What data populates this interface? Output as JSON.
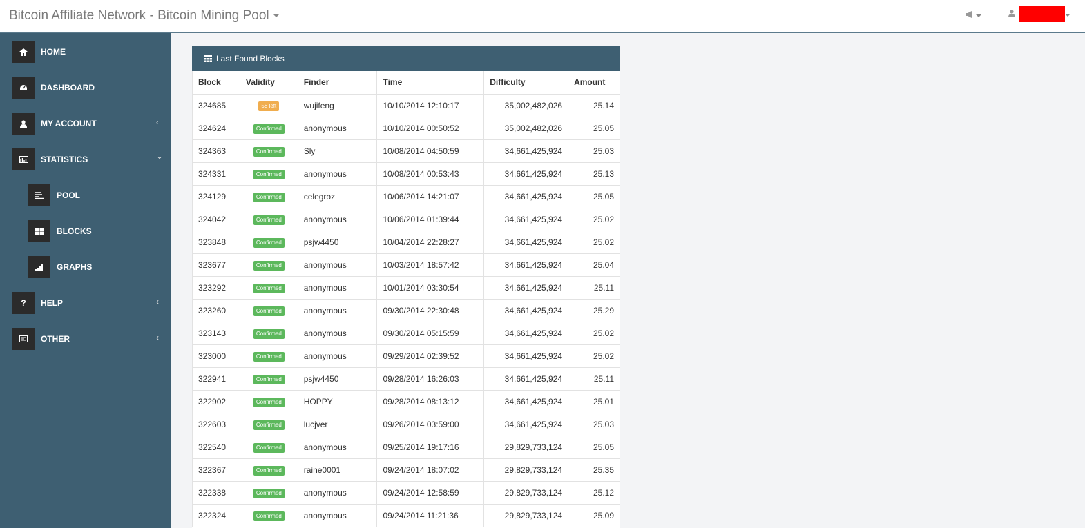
{
  "header": {
    "brand": "Bitcoin Affiliate Network - Bitcoin Mining Pool",
    "notify_icon": "bullhorn-icon",
    "user_icon": "user-icon"
  },
  "sidebar": {
    "items": [
      {
        "label": "HOME",
        "icon": "home-icon"
      },
      {
        "label": "DASHBOARD",
        "icon": "dashboard-icon"
      },
      {
        "label": "MY ACCOUNT",
        "icon": "user-icon",
        "chevron": "‹"
      },
      {
        "label": "STATISTICS",
        "icon": "chart-icon",
        "chevron": "⌄"
      },
      {
        "label": "POOL",
        "icon": "list-icon"
      },
      {
        "label": "BLOCKS",
        "icon": "table-icon"
      },
      {
        "label": "GRAPHS",
        "icon": "signal-icon"
      },
      {
        "label": "HELP",
        "icon": "question-icon",
        "chevron": "‹"
      },
      {
        "label": "OTHER",
        "icon": "other-icon",
        "chevron": "‹"
      }
    ]
  },
  "panel": {
    "title": "Last Found Blocks",
    "columns": [
      "Block",
      "Validity",
      "Finder",
      "Time",
      "Difficulty",
      "Amount"
    ],
    "rows": [
      {
        "block": "324685",
        "validity": "58 left",
        "status": "left",
        "finder": "wujifeng",
        "time": "10/10/2014 12:10:17",
        "difficulty": "35,002,482,026",
        "amount": "25.14"
      },
      {
        "block": "324624",
        "validity": "Confirmed",
        "status": "ok",
        "finder": "anonymous",
        "time": "10/10/2014 00:50:52",
        "difficulty": "35,002,482,026",
        "amount": "25.05"
      },
      {
        "block": "324363",
        "validity": "Confirmed",
        "status": "ok",
        "finder": "Sly",
        "time": "10/08/2014 04:50:59",
        "difficulty": "34,661,425,924",
        "amount": "25.03"
      },
      {
        "block": "324331",
        "validity": "Confirmed",
        "status": "ok",
        "finder": "anonymous",
        "time": "10/08/2014 00:53:43",
        "difficulty": "34,661,425,924",
        "amount": "25.13"
      },
      {
        "block": "324129",
        "validity": "Confirmed",
        "status": "ok",
        "finder": "celegroz",
        "time": "10/06/2014 14:21:07",
        "difficulty": "34,661,425,924",
        "amount": "25.05"
      },
      {
        "block": "324042",
        "validity": "Confirmed",
        "status": "ok",
        "finder": "anonymous",
        "time": "10/06/2014 01:39:44",
        "difficulty": "34,661,425,924",
        "amount": "25.02"
      },
      {
        "block": "323848",
        "validity": "Confirmed",
        "status": "ok",
        "finder": "psjw4450",
        "time": "10/04/2014 22:28:27",
        "difficulty": "34,661,425,924",
        "amount": "25.02"
      },
      {
        "block": "323677",
        "validity": "Confirmed",
        "status": "ok",
        "finder": "anonymous",
        "time": "10/03/2014 18:57:42",
        "difficulty": "34,661,425,924",
        "amount": "25.04"
      },
      {
        "block": "323292",
        "validity": "Confirmed",
        "status": "ok",
        "finder": "anonymous",
        "time": "10/01/2014 03:30:54",
        "difficulty": "34,661,425,924",
        "amount": "25.11"
      },
      {
        "block": "323260",
        "validity": "Confirmed",
        "status": "ok",
        "finder": "anonymous",
        "time": "09/30/2014 22:30:48",
        "difficulty": "34,661,425,924",
        "amount": "25.29"
      },
      {
        "block": "323143",
        "validity": "Confirmed",
        "status": "ok",
        "finder": "anonymous",
        "time": "09/30/2014 05:15:59",
        "difficulty": "34,661,425,924",
        "amount": "25.02"
      },
      {
        "block": "323000",
        "validity": "Confirmed",
        "status": "ok",
        "finder": "anonymous",
        "time": "09/29/2014 02:39:52",
        "difficulty": "34,661,425,924",
        "amount": "25.02"
      },
      {
        "block": "322941",
        "validity": "Confirmed",
        "status": "ok",
        "finder": "psjw4450",
        "time": "09/28/2014 16:26:03",
        "difficulty": "34,661,425,924",
        "amount": "25.11"
      },
      {
        "block": "322902",
        "validity": "Confirmed",
        "status": "ok",
        "finder": "HOPPY",
        "time": "09/28/2014 08:13:12",
        "difficulty": "34,661,425,924",
        "amount": "25.01"
      },
      {
        "block": "322603",
        "validity": "Confirmed",
        "status": "ok",
        "finder": "lucjver",
        "time": "09/26/2014 03:59:00",
        "difficulty": "34,661,425,924",
        "amount": "25.03"
      },
      {
        "block": "322540",
        "validity": "Confirmed",
        "status": "ok",
        "finder": "anonymous",
        "time": "09/25/2014 19:17:16",
        "difficulty": "29,829,733,124",
        "amount": "25.05"
      },
      {
        "block": "322367",
        "validity": "Confirmed",
        "status": "ok",
        "finder": "raine0001",
        "time": "09/24/2014 18:07:02",
        "difficulty": "29,829,733,124",
        "amount": "25.35"
      },
      {
        "block": "322338",
        "validity": "Confirmed",
        "status": "ok",
        "finder": "anonymous",
        "time": "09/24/2014 12:58:59",
        "difficulty": "29,829,733,124",
        "amount": "25.12"
      },
      {
        "block": "322324",
        "validity": "Confirmed",
        "status": "ok",
        "finder": "anonymous",
        "time": "09/24/2014 11:21:36",
        "difficulty": "29,829,733,124",
        "amount": "25.09"
      }
    ]
  }
}
